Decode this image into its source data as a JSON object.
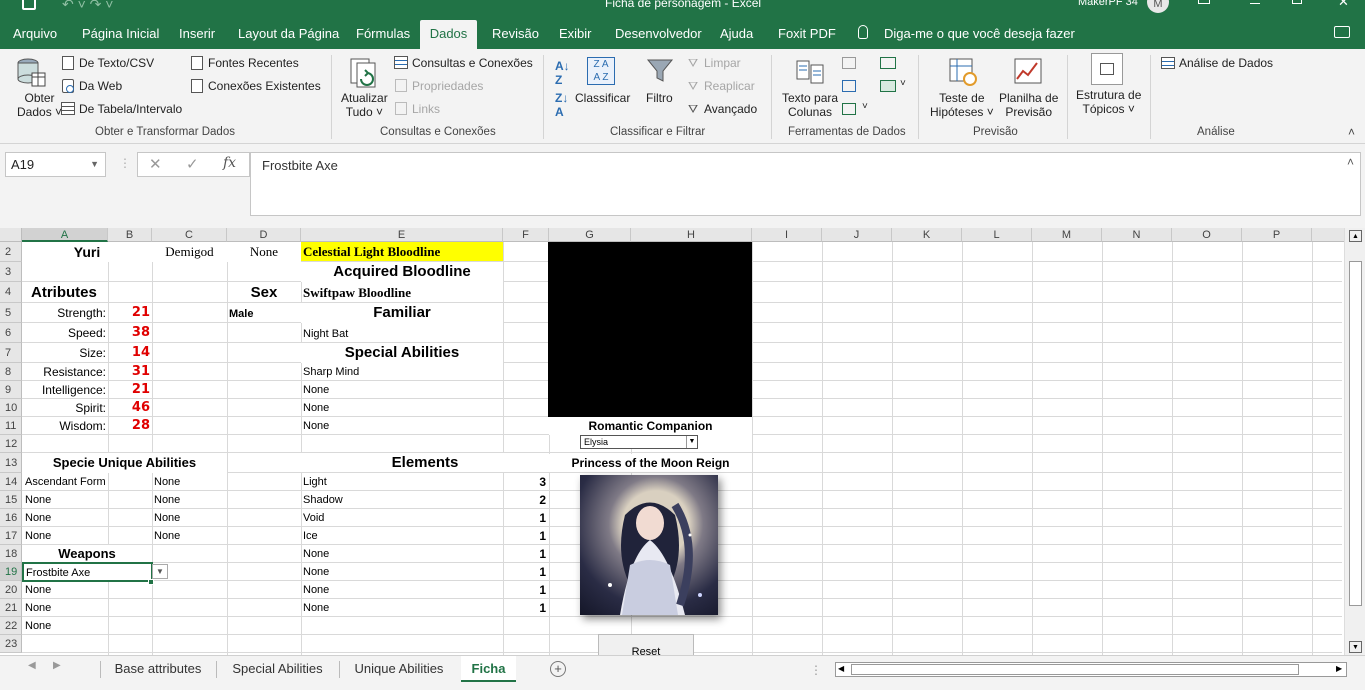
{
  "window": {
    "title": "Ficha de personagem  -  Excel",
    "user": "MakerPF 34",
    "avatar_initial": "M"
  },
  "ribbon_tabs": [
    "Arquivo",
    "Página Inicial",
    "Inserir",
    "Layout da Página",
    "Fórmulas",
    "Dados",
    "Revisão",
    "Exibir",
    "Desenvolvedor",
    "Ajuda",
    "Foxit PDF"
  ],
  "active_tab": "Dados",
  "tell_me": "Diga-me o que você deseja fazer",
  "ribbon": {
    "obter_dados": [
      "Obter",
      "Dados ˅"
    ],
    "de_texto_csv": "De Texto/CSV",
    "da_web": "Da Web",
    "de_tabela": "De Tabela/Intervalo",
    "fontes_recentes": "Fontes Recentes",
    "conexoes_existentes": "Conexões Existentes",
    "atualizar": [
      "Atualizar",
      "Tudo ˅"
    ],
    "consultas_conexoes": "Consultas e Conexões",
    "propriedades": "Propriedades",
    "links": "Links",
    "classificar": "Classificar",
    "filtro": "Filtro",
    "limpar": "Limpar",
    "reaplicar": "Reaplicar",
    "avancado": "Avançado",
    "texto_colunas": [
      "Texto para",
      "Colunas"
    ],
    "teste_hipoteses": [
      "Teste de",
      "Hipóteses ˅"
    ],
    "planilha_previsao": [
      "Planilha de",
      "Previsão"
    ],
    "estrutura_topicos": [
      "Estrutura de",
      "Tópicos ˅"
    ],
    "analise_dados": "Análise de Dados",
    "groups": [
      "Obter e Transformar Dados",
      "Consultas e Conexões",
      "Classificar e Filtrar",
      "Ferramentas de Dados",
      "Previsão",
      "Análise"
    ]
  },
  "name_box": "A19",
  "formula": "Frostbite Axe",
  "columns": [
    "A",
    "B",
    "C",
    "D",
    "E",
    "F",
    "G",
    "H",
    "I",
    "J",
    "K",
    "L",
    "M",
    "N",
    "O",
    "P"
  ],
  "rows": [
    "2",
    "3",
    "4",
    "5",
    "6",
    "7",
    "8",
    "9",
    "10",
    "11",
    "12",
    "13",
    "14",
    "15",
    "16",
    "17",
    "18",
    "19",
    "20",
    "21",
    "22",
    "23"
  ],
  "sheet": {
    "name": "Yuri",
    "race": "Demigod",
    "none_d2": "None",
    "bloodline": "Celestial Light Bloodline",
    "acquired_bloodline_title": "Acquired Bloodline",
    "atributes_title": "Atributes",
    "sex_title": "Sex",
    "sex_value": "Male",
    "acquired_bloodline": "Swiftpaw Bloodline",
    "familiar_title": "Familiar",
    "familiar": "Night Bat",
    "special_title": "Special Abilities",
    "special": [
      "Sharp Mind",
      "None",
      "None",
      "None"
    ],
    "attributes": [
      {
        "label": "Strength:",
        "value": "21"
      },
      {
        "label": "Speed:",
        "value": "38"
      },
      {
        "label": "Size:",
        "value": "14"
      },
      {
        "label": "Resistance:",
        "value": "31"
      },
      {
        "label": "Intelligence:",
        "value": "21"
      },
      {
        "label": "Spirit:",
        "value": "46"
      },
      {
        "label": "Wisdom:",
        "value": "28"
      }
    ],
    "specie_title": "Specie Unique Abilities",
    "specie_a": [
      "Ascendant Form",
      "None",
      "None",
      "None"
    ],
    "specie_c": [
      "None",
      "None",
      "None",
      "None"
    ],
    "elements_title": "Elements",
    "elements": [
      {
        "name": "Light",
        "value": "3"
      },
      {
        "name": "Shadow",
        "value": "2"
      },
      {
        "name": "Void",
        "value": "1"
      },
      {
        "name": "Ice",
        "value": "1"
      },
      {
        "name": "None",
        "value": "1"
      },
      {
        "name": "None",
        "value": "1"
      },
      {
        "name": "None",
        "value": "1"
      },
      {
        "name": "None",
        "value": "1"
      }
    ],
    "weapons_title": "Weapons",
    "weapons": [
      "Frostbite Axe",
      "None",
      "None",
      "None"
    ],
    "romantic_title": "Romantic Companion",
    "romantic_value": "Elysia",
    "princess_title": "Princess of the Moon Reign",
    "reset_label": "Reset"
  },
  "sheet_tabs": [
    "Base attributes",
    "Special Abilities",
    "Unique Abilities",
    "Ficha"
  ],
  "active_sheet": "Ficha",
  "colors": {
    "excel_green": "#217346",
    "highlight": "#ffff00",
    "stat_red": "#e00000"
  }
}
